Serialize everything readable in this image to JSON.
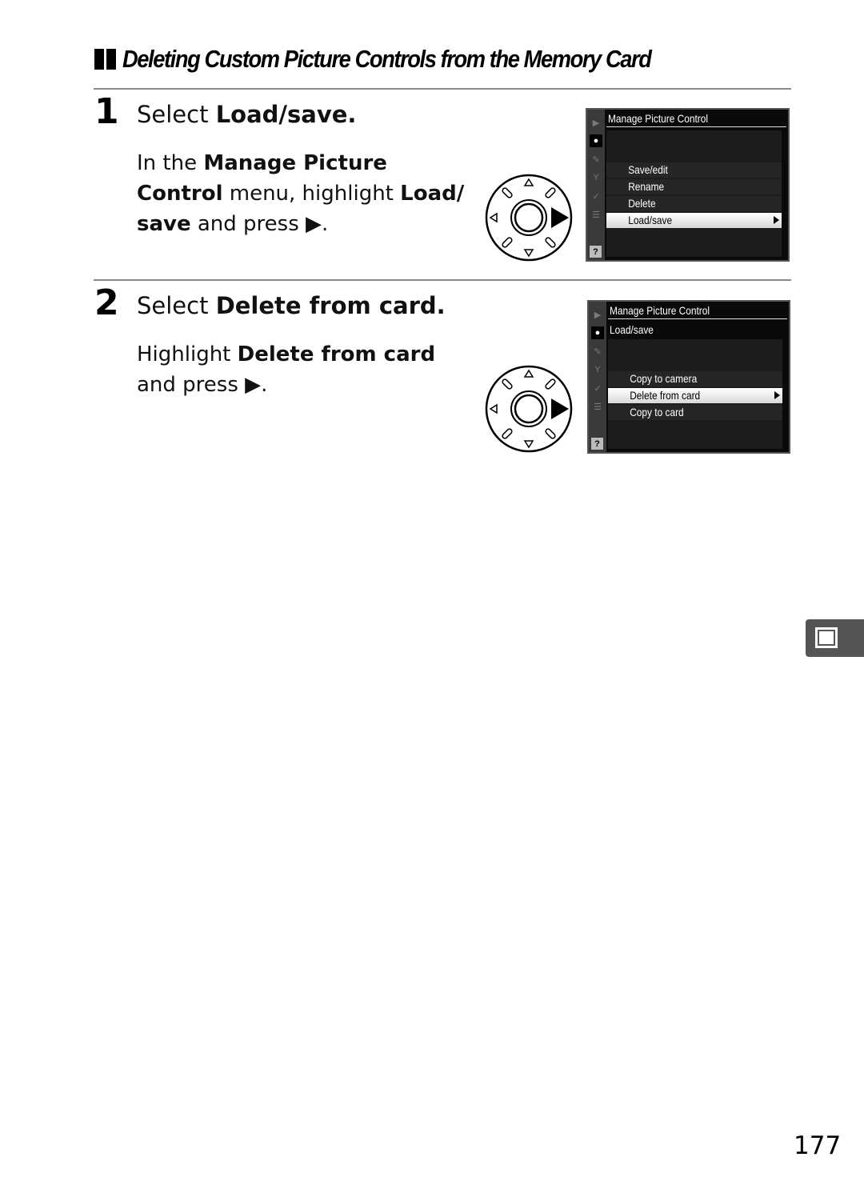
{
  "section": {
    "title": "Deleting Custom Picture Controls from the Memory Card"
  },
  "steps": [
    {
      "number": "1",
      "title_prefix": "Select ",
      "title_bold": "Load/save",
      "title_suffix": ".",
      "body": [
        {
          "text": "In the ",
          "bold": false
        },
        {
          "text": "Manage Picture Control",
          "bold": true
        },
        {
          "text": " menu, highlight ",
          "bold": false
        },
        {
          "text": "Load/ save",
          "bold": true
        },
        {
          "text": " and press ▶.",
          "bold": false
        }
      ],
      "body_lines": {
        "l1a": "In the ",
        "l1b": "Manage Picture",
        "l2a": "Control",
        "l2b": " menu, highlight ",
        "l2c": "Load/",
        "l3a": "save",
        "l3b": " and press ▶."
      },
      "screen": {
        "title": "Manage Picture Control",
        "subtitle": "",
        "items": [
          {
            "label": "Save/edit",
            "highlighted": false
          },
          {
            "label": "Rename",
            "highlighted": false
          },
          {
            "label": "Delete",
            "highlighted": false
          },
          {
            "label": "Load/save",
            "highlighted": true
          }
        ]
      }
    },
    {
      "number": "2",
      "title_prefix": "Select ",
      "title_bold": "Delete from card",
      "title_suffix": ".",
      "body_lines": {
        "l1a": "Highlight ",
        "l1b": "Delete from card",
        "l2a": "and press ▶."
      },
      "screen": {
        "title": "Manage Picture Control",
        "subtitle": "Load/save",
        "items": [
          {
            "label": "Copy to camera",
            "highlighted": false
          },
          {
            "label": "Delete from card",
            "highlighted": true
          },
          {
            "label": "Copy to card",
            "highlighted": false
          }
        ]
      }
    }
  ],
  "sidebar_icons": [
    "playback-menu-icon",
    "shooting-menu-icon",
    "custom-settings-icon",
    "setup-menu-icon",
    "retouch-menu-icon",
    "my-menu-icon",
    "help-icon"
  ],
  "help_glyph": "?",
  "page_number": "177",
  "colors": {
    "rule": "#8a8a8a",
    "tab": "#555555",
    "lcd_bg": "#0a0a0a"
  }
}
